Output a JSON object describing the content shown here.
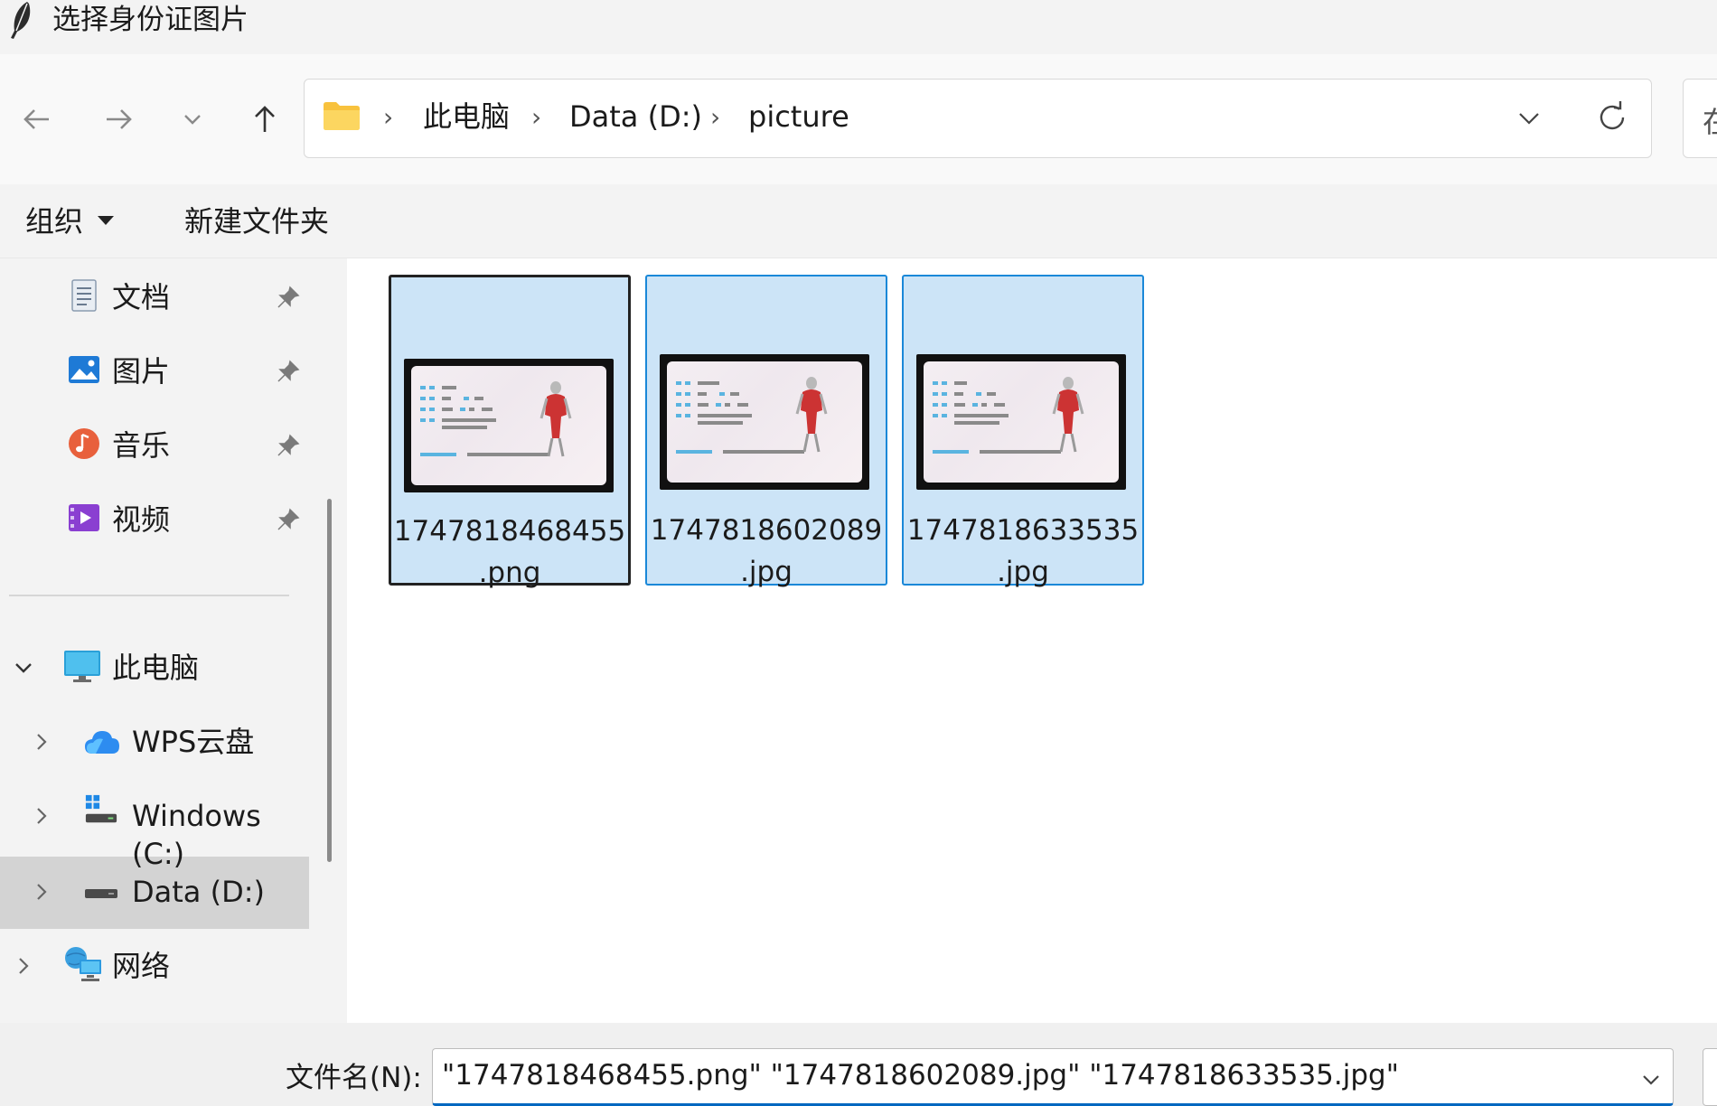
{
  "window": {
    "title": "选择身份证图片"
  },
  "nav": {
    "back_icon": "arrow-left-icon",
    "forward_icon": "arrow-right-icon",
    "recent_icon": "chevron-down-icon",
    "up_icon": "arrow-up-icon"
  },
  "breadcrumb": {
    "items": [
      "此电脑",
      "Data (D:)",
      "picture"
    ],
    "separator": "›"
  },
  "search": {
    "hint": "在"
  },
  "toolbar": {
    "organize_label": "组织",
    "new_folder_label": "新建文件夹"
  },
  "sidebar": {
    "quick_access": [
      {
        "label": "文档",
        "icon": "document-icon"
      },
      {
        "label": "图片",
        "icon": "pictures-icon"
      },
      {
        "label": "音乐",
        "icon": "music-icon"
      },
      {
        "label": "视频",
        "icon": "video-icon"
      }
    ],
    "this_pc": {
      "label": "此电脑",
      "icon": "computer-icon"
    },
    "drives": [
      {
        "label": "WPS云盘",
        "icon": "cloud-icon"
      },
      {
        "label": "Windows (C:)",
        "icon": "windows-drive-icon"
      },
      {
        "label": "Data (D:)",
        "icon": "drive-icon",
        "selected": true
      }
    ],
    "network": {
      "label": "网络",
      "icon": "network-icon"
    }
  },
  "files": [
    {
      "name_line1": "1747818468455",
      "name_line2": ".png",
      "selected": true,
      "focused": true
    },
    {
      "name_line1": "1747818602089",
      "name_line2": ".jpg",
      "selected": true,
      "focused": false
    },
    {
      "name_line1": "1747818633535",
      "name_line2": ".jpg",
      "selected": true,
      "focused": false
    }
  ],
  "filename": {
    "label": "文件名(N):",
    "value": "\"1747818468455.png\" \"1747818602089.jpg\" \"1747818633535.jpg\""
  },
  "colors": {
    "accent": "#0067c0",
    "selection_fill": "#cce4f7",
    "selection_border": "#1a88d8",
    "folder_yellow": "#f8c23d"
  }
}
